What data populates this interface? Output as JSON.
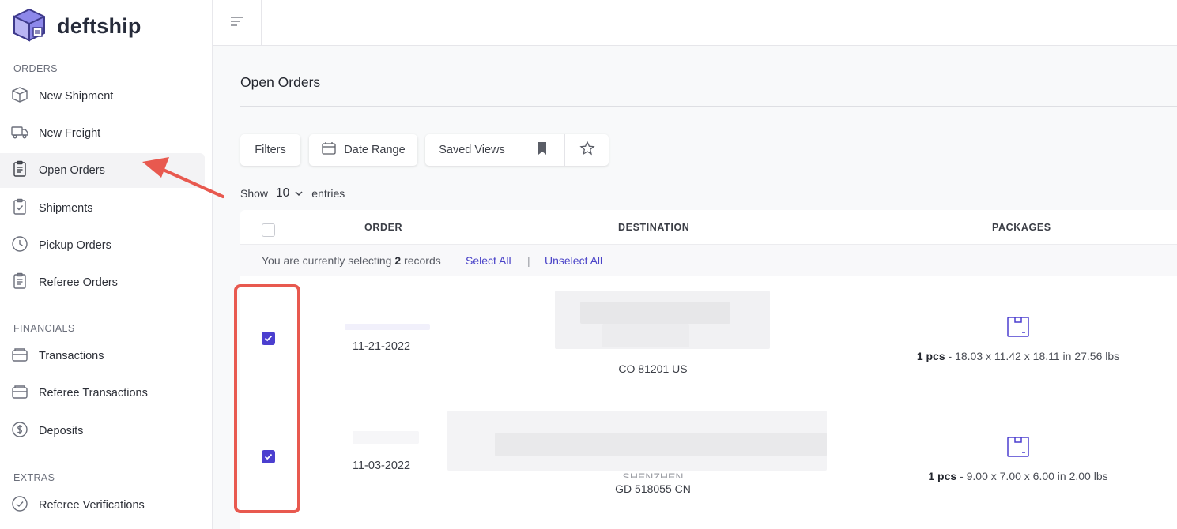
{
  "brand": {
    "name": "deftship"
  },
  "sidebar": {
    "sections": [
      {
        "title": "ORDERS"
      },
      {
        "title": "FINANCIALS"
      },
      {
        "title": "EXTRAS"
      }
    ],
    "items": [
      {
        "label": "New Shipment",
        "icon": "box-icon"
      },
      {
        "label": "New Freight",
        "icon": "truck-icon"
      },
      {
        "label": "Open Orders",
        "icon": "clipboard-icon",
        "active": true
      },
      {
        "label": "Shipments",
        "icon": "clipboard-check-icon"
      },
      {
        "label": "Pickup Orders",
        "icon": "clock-icon"
      },
      {
        "label": "Referee Orders",
        "icon": "clipboard-icon"
      },
      {
        "label": "Transactions",
        "icon": "wallet-icon"
      },
      {
        "label": "Referee Transactions",
        "icon": "wallet-icon"
      },
      {
        "label": "Deposits",
        "icon": "dollar-circle-icon"
      },
      {
        "label": "Referee Verifications",
        "icon": "check-circle-icon"
      }
    ]
  },
  "main": {
    "title": "Open Orders",
    "toolbar": {
      "filters": "Filters",
      "date_range": "Date Range",
      "saved_views": "Saved Views"
    },
    "show": {
      "prefix": "Show",
      "value": "10",
      "suffix": "entries"
    },
    "table": {
      "columns": [
        "ORDER",
        "DESTINATION",
        "PACKAGES"
      ],
      "selection": {
        "text_prefix": "You are currently selecting",
        "count": "2",
        "text_suffix": "records",
        "select_all": "Select All",
        "separator": "|",
        "unselect_all": "Unselect All"
      },
      "rows": [
        {
          "checked": true,
          "date": "11-21-2022",
          "address_line_1": "",
          "address_line_2": "CO 81201 US",
          "pkg_count": "1 pcs",
          "pkg_detail": " - 18.03 x 11.42 x 18.11 in  27.56 lbs"
        },
        {
          "checked": true,
          "date": "11-03-2022",
          "address_line_1": "SHENZHEN",
          "address_line_2": "GD 518055 CN",
          "pkg_count": "1 pcs",
          "pkg_detail": " - 9.00 x 7.00 x 6.00 in  2.00 lbs"
        }
      ]
    }
  },
  "colors": {
    "accent": "#4b3fcf",
    "annotation": "#e8594f",
    "link": "#4a43c8"
  }
}
